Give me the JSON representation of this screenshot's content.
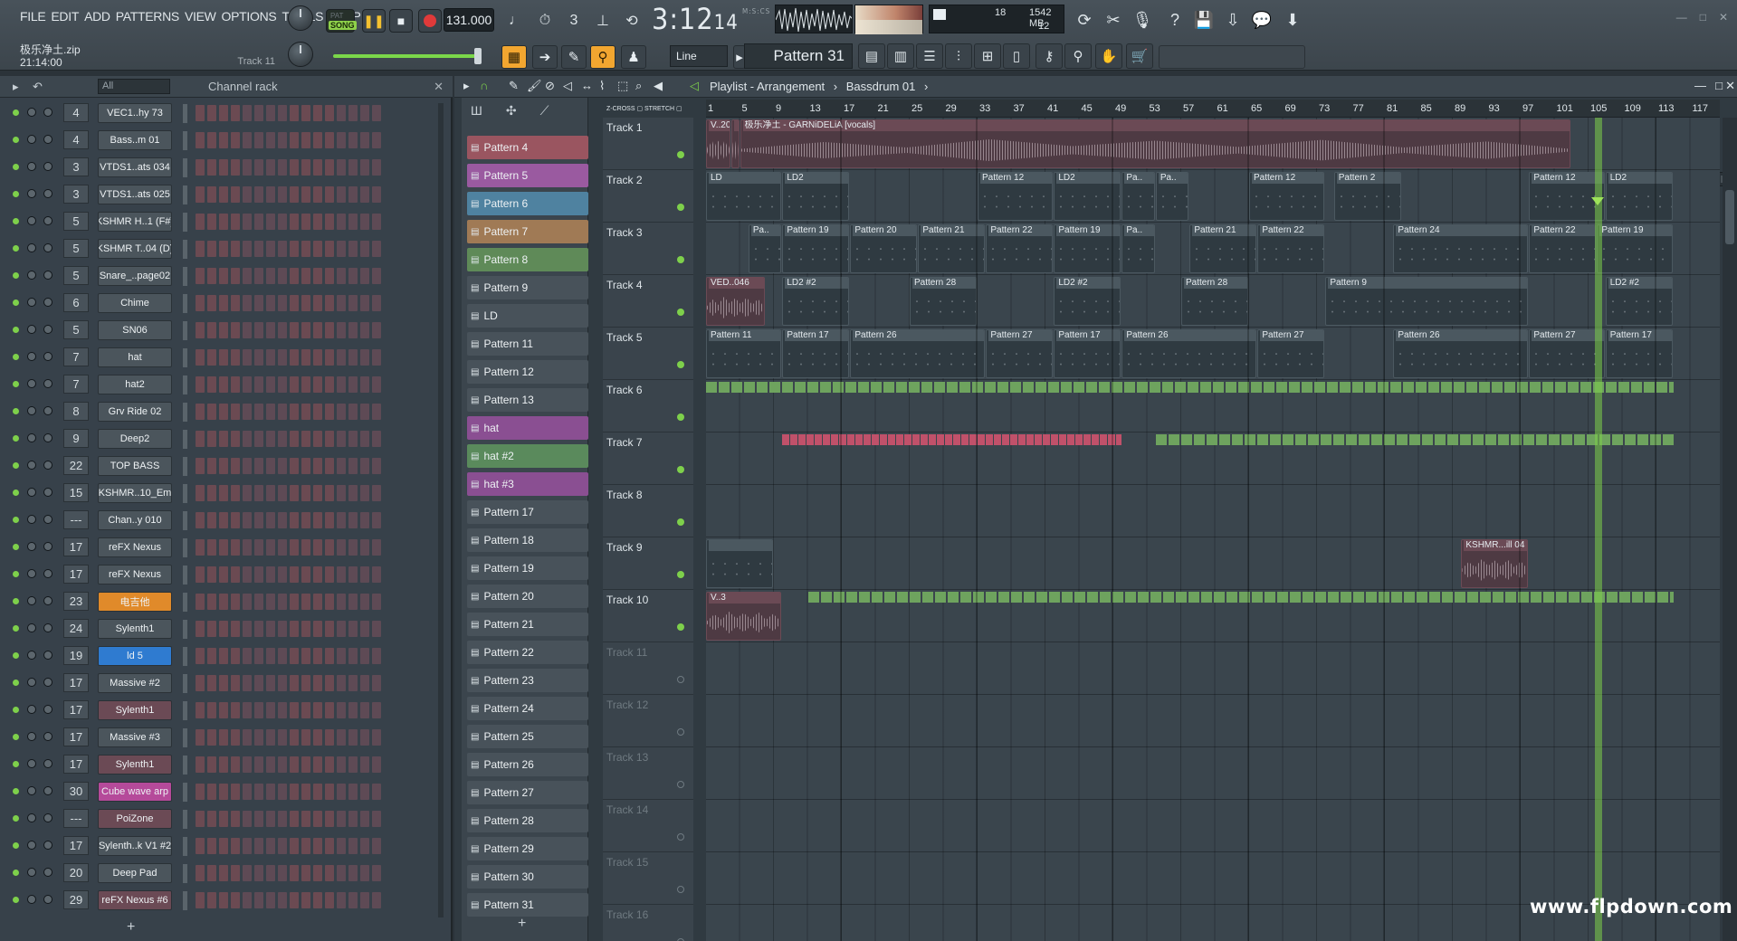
{
  "menu": [
    "FILE",
    "EDIT",
    "ADD",
    "PATTERNS",
    "VIEW",
    "OPTIONS",
    "TOOLS",
    "HELP"
  ],
  "hint": {
    "file": "极乐净土.zip",
    "time": "21:14:00",
    "track": "Track 11"
  },
  "transport": {
    "pat_label": "PAT",
    "song_label": "SONG",
    "tempo": "131.000",
    "clock_main": "3:12",
    "clock_sub": "14",
    "clock_unit": "M:S:CS"
  },
  "cpu": {
    "voices": "18",
    "mem": "1542 MB",
    "cpu": "12"
  },
  "snap": {
    "mode": "Line",
    "pattern": "Pattern 31"
  },
  "rack": {
    "filter": "All",
    "title": "Channel rack",
    "channels": [
      {
        "num": "4",
        "name": "VEC1..hy 73",
        "color": "#4b555c"
      },
      {
        "num": "4",
        "name": "Bass..m 01",
        "color": "#4b555c"
      },
      {
        "num": "3",
        "name": "VTDS1..ats 034",
        "color": "#4b555c"
      },
      {
        "num": "3",
        "name": "VTDS1..ats 025",
        "color": "#4b555c"
      },
      {
        "num": "5",
        "name": "KSHMR H..1 (F#)",
        "color": "#4b555c"
      },
      {
        "num": "5",
        "name": "KSHMR T..04 (D)",
        "color": "#4b555c"
      },
      {
        "num": "5",
        "name": "Snare_..page02",
        "color": "#4b555c"
      },
      {
        "num": "6",
        "name": "Chime",
        "color": "#4b555c"
      },
      {
        "num": "5",
        "name": "SN06",
        "color": "#4b555c"
      },
      {
        "num": "7",
        "name": "hat",
        "color": "#4b555c"
      },
      {
        "num": "7",
        "name": "hat2",
        "color": "#4b555c"
      },
      {
        "num": "8",
        "name": "Grv Ride 02",
        "color": "#4b555c"
      },
      {
        "num": "9",
        "name": "Deep2",
        "color": "#4b555c"
      },
      {
        "num": "22",
        "name": "TOP BASS",
        "color": "#4b555c"
      },
      {
        "num": "15",
        "name": "KSHMR..10_Em",
        "color": "#4b555c"
      },
      {
        "num": "---",
        "name": "Chan..y 010",
        "color": "#4b555c"
      },
      {
        "num": "17",
        "name": "reFX Nexus",
        "color": "#4b555c"
      },
      {
        "num": "17",
        "name": "reFX Nexus",
        "color": "#4b555c"
      },
      {
        "num": "23",
        "name": "电吉他",
        "color": "#e08a2a"
      },
      {
        "num": "24",
        "name": "Sylenth1",
        "color": "#4b555c"
      },
      {
        "num": "19",
        "name": "ld 5",
        "color": "#2f7bd0"
      },
      {
        "num": "17",
        "name": "Massive #2",
        "color": "#4b555c"
      },
      {
        "num": "17",
        "name": "Sylenth1",
        "color": "#6b4a55"
      },
      {
        "num": "17",
        "name": "Massive #3",
        "color": "#4b555c"
      },
      {
        "num": "17",
        "name": "Sylenth1",
        "color": "#6b4a55"
      },
      {
        "num": "30",
        "name": "Cube wave arp",
        "color": "#b54a9a"
      },
      {
        "num": "---",
        "name": "PoiZone",
        "color": "#6b4a55"
      },
      {
        "num": "17",
        "name": "Sylenth..k V1 #2",
        "color": "#4b555c"
      },
      {
        "num": "20",
        "name": "Deep Pad",
        "color": "#4b555c"
      },
      {
        "num": "29",
        "name": "reFX Nexus #6",
        "color": "#6b4a55"
      }
    ]
  },
  "playlist": {
    "title": "Playlist - Arrangement",
    "crumb": "Bassdrum 01",
    "ruler": [
      "1",
      "5",
      "9",
      "13",
      "17",
      "21",
      "25",
      "29",
      "33",
      "37",
      "41",
      "45",
      "49",
      "53",
      "57",
      "61",
      "65",
      "69",
      "73",
      "77",
      "81",
      "85",
      "89",
      "93",
      "97",
      "101",
      "105",
      "109",
      "113",
      "117"
    ],
    "patterns": [
      {
        "name": "Pattern 4",
        "color": "#9a5560"
      },
      {
        "name": "Pattern 5",
        "color": "#9a5aa0"
      },
      {
        "name": "Pattern 6",
        "color": "#4f82a0"
      },
      {
        "name": "Pattern 7",
        "color": "#a07a55"
      },
      {
        "name": "Pattern 8",
        "color": "#5f8a58"
      },
      {
        "name": "Pattern 9",
        "color": "#48525a"
      },
      {
        "name": "LD",
        "color": "#48525a"
      },
      {
        "name": "Pattern 11",
        "color": "#48525a"
      },
      {
        "name": "Pattern 12",
        "color": "#48525a"
      },
      {
        "name": "Pattern 13",
        "color": "#48525a"
      },
      {
        "name": "hat",
        "color": "#8a4f92"
      },
      {
        "name": "hat #2",
        "color": "#5a8a5c"
      },
      {
        "name": "hat #3",
        "color": "#8a4f92"
      },
      {
        "name": "Pattern 17",
        "color": "#48525a"
      },
      {
        "name": "Pattern 18",
        "color": "#48525a"
      },
      {
        "name": "Pattern 19",
        "color": "#48525a"
      },
      {
        "name": "Pattern 20",
        "color": "#48525a"
      },
      {
        "name": "Pattern 21",
        "color": "#48525a"
      },
      {
        "name": "Pattern 22",
        "color": "#48525a"
      },
      {
        "name": "Pattern 23",
        "color": "#48525a"
      },
      {
        "name": "Pattern 24",
        "color": "#48525a"
      },
      {
        "name": "Pattern 25",
        "color": "#48525a"
      },
      {
        "name": "Pattern 26",
        "color": "#48525a"
      },
      {
        "name": "Pattern 27",
        "color": "#48525a"
      },
      {
        "name": "Pattern 28",
        "color": "#48525a"
      },
      {
        "name": "Pattern 29",
        "color": "#48525a"
      },
      {
        "name": "Pattern 30",
        "color": "#48525a"
      },
      {
        "name": "Pattern 31",
        "color": "#48525a"
      }
    ],
    "tracks": [
      "Track 1",
      "Track 2",
      "Track 3",
      "Track 4",
      "Track 5",
      "Track 6",
      "Track 7",
      "Track 8",
      "Track 9",
      "Track 10",
      "Track 11",
      "Track 12",
      "Track 13",
      "Track 14",
      "Track 15",
      "Track 16"
    ],
    "clips": [
      {
        "track": 0,
        "bar": 1,
        "len": 3,
        "kind": "aud",
        "name": "V..20"
      },
      {
        "track": 0,
        "bar": 4,
        "len": 1,
        "kind": "aud",
        "name": ""
      },
      {
        "track": 0,
        "bar": 5,
        "len": 98,
        "kind": "aud",
        "name": "极乐净土 - GARNiDELiA [vocals]"
      },
      {
        "track": 1,
        "bar": 1,
        "len": 9,
        "kind": "pat",
        "name": "LD"
      },
      {
        "track": 1,
        "bar": 10,
        "len": 8,
        "kind": "pat",
        "name": "LD2"
      },
      {
        "track": 1,
        "bar": 33,
        "len": 9,
        "kind": "pat",
        "name": "Pattern 12"
      },
      {
        "track": 1,
        "bar": 42,
        "len": 8,
        "kind": "pat",
        "name": "LD2"
      },
      {
        "track": 1,
        "bar": 50,
        "len": 4,
        "kind": "pat",
        "name": "Pa.."
      },
      {
        "track": 1,
        "bar": 54,
        "len": 4,
        "kind": "pat",
        "name": "Pa.."
      },
      {
        "track": 1,
        "bar": 65,
        "len": 9,
        "kind": "pat",
        "name": "Pattern 12"
      },
      {
        "track": 1,
        "bar": 75,
        "len": 8,
        "kind": "pat",
        "name": "Pattern 2"
      },
      {
        "track": 1,
        "bar": 98,
        "len": 9,
        "kind": "pat",
        "name": "Pattern 12"
      },
      {
        "track": 1,
        "bar": 107,
        "len": 8,
        "kind": "pat",
        "name": "LD2"
      },
      {
        "track": 2,
        "bar": 6,
        "len": 4,
        "kind": "pat",
        "name": "Pa.."
      },
      {
        "track": 2,
        "bar": 10,
        "len": 8,
        "kind": "pat",
        "name": "Pattern 19"
      },
      {
        "track": 2,
        "bar": 18,
        "len": 8,
        "kind": "pat",
        "name": "Pattern 20"
      },
      {
        "track": 2,
        "bar": 26,
        "len": 8,
        "kind": "pat",
        "name": "Pattern 21"
      },
      {
        "track": 2,
        "bar": 34,
        "len": 8,
        "kind": "pat",
        "name": "Pattern 22"
      },
      {
        "track": 2,
        "bar": 42,
        "len": 8,
        "kind": "pat",
        "name": "Pattern 19"
      },
      {
        "track": 2,
        "bar": 50,
        "len": 4,
        "kind": "pat",
        "name": "Pa.."
      },
      {
        "track": 2,
        "bar": 58,
        "len": 8,
        "kind": "pat",
        "name": "Pattern 21"
      },
      {
        "track": 2,
        "bar": 66,
        "len": 8,
        "kind": "pat",
        "name": "Pattern 22"
      },
      {
        "track": 2,
        "bar": 82,
        "len": 16,
        "kind": "pat",
        "name": "Pattern 24"
      },
      {
        "track": 2,
        "bar": 98,
        "len": 8,
        "kind": "pat",
        "name": "Pattern 22"
      },
      {
        "track": 2,
        "bar": 106,
        "len": 9,
        "kind": "pat",
        "name": "Pattern 19"
      },
      {
        "track": 3,
        "bar": 1,
        "len": 7,
        "kind": "aud",
        "name": "VED..046"
      },
      {
        "track": 3,
        "bar": 10,
        "len": 8,
        "kind": "pat",
        "name": "LD2 #2"
      },
      {
        "track": 3,
        "bar": 25,
        "len": 8,
        "kind": "pat",
        "name": "Pattern 28"
      },
      {
        "track": 3,
        "bar": 42,
        "len": 8,
        "kind": "pat",
        "name": "LD2 #2"
      },
      {
        "track": 3,
        "bar": 57,
        "len": 8,
        "kind": "pat",
        "name": "Pattern 28"
      },
      {
        "track": 3,
        "bar": 74,
        "len": 24,
        "kind": "pat",
        "name": "Pattern 9"
      },
      {
        "track": 3,
        "bar": 107,
        "len": 8,
        "kind": "pat",
        "name": "LD2 #2"
      },
      {
        "track": 4,
        "bar": 1,
        "len": 9,
        "kind": "pat",
        "name": "Pattern 11"
      },
      {
        "track": 4,
        "bar": 10,
        "len": 8,
        "kind": "pat",
        "name": "Pattern 17"
      },
      {
        "track": 4,
        "bar": 18,
        "len": 16,
        "kind": "pat",
        "name": "Pattern 26"
      },
      {
        "track": 4,
        "bar": 34,
        "len": 8,
        "kind": "pat",
        "name": "Pattern 27"
      },
      {
        "track": 4,
        "bar": 42,
        "len": 8,
        "kind": "pat",
        "name": "Pattern 17"
      },
      {
        "track": 4,
        "bar": 50,
        "len": 16,
        "kind": "pat",
        "name": "Pattern 26"
      },
      {
        "track": 4,
        "bar": 66,
        "len": 8,
        "kind": "pat",
        "name": "Pattern 27"
      },
      {
        "track": 4,
        "bar": 82,
        "len": 16,
        "kind": "pat",
        "name": "Pattern 26"
      },
      {
        "track": 4,
        "bar": 98,
        "len": 9,
        "kind": "pat",
        "name": "Pattern 27"
      },
      {
        "track": 4,
        "bar": 107,
        "len": 8,
        "kind": "pat",
        "name": "Pattern 17"
      },
      {
        "track": 8,
        "bar": 1,
        "len": 8,
        "kind": "pat",
        "name": ""
      },
      {
        "track": 8,
        "bar": 90,
        "len": 8,
        "kind": "aud",
        "name": "KSHMR...ill 04"
      },
      {
        "track": 9,
        "bar": 1,
        "len": 9,
        "kind": "aud",
        "name": "V..3"
      }
    ],
    "stripes": [
      {
        "track": 5,
        "bar": 1,
        "len": 114,
        "style": "green"
      },
      {
        "track": 6,
        "bar": 10,
        "len": 40,
        "style": "pink"
      },
      {
        "track": 6,
        "bar": 54,
        "len": 61,
        "style": "green"
      },
      {
        "track": 9,
        "bar": 13,
        "len": 102,
        "style": "green"
      }
    ]
  },
  "watermark": "www.flpdown.com"
}
